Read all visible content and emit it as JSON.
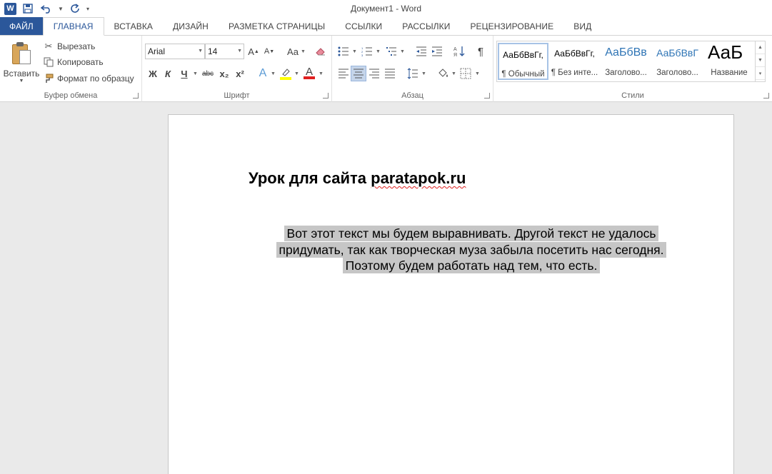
{
  "titlebar": {
    "title": "Документ1 - Word"
  },
  "tabs": [
    "ФАЙЛ",
    "ГЛАВНАЯ",
    "ВСТАВКА",
    "ДИЗАЙН",
    "РАЗМЕТКА СТРАНИЦЫ",
    "ССЫЛКИ",
    "РАССЫЛКИ",
    "РЕЦЕНЗИРОВАНИЕ",
    "ВИД"
  ],
  "clipboard": {
    "paste": "Вставить",
    "cut": "Вырезать",
    "copy": "Копировать",
    "format_painter": "Формат по образцу",
    "label": "Буфер обмена"
  },
  "font": {
    "name": "Arial",
    "size": "14",
    "grow": "A",
    "shrink": "A",
    "case": "Aa",
    "bold": "Ж",
    "italic": "К",
    "underline": "Ч",
    "strike": "abc",
    "subscript": "x₂",
    "superscript": "x²",
    "effects": "A",
    "color": "A",
    "label": "Шрифт",
    "highlight_color": "#ffff00",
    "font_color": "#e02020"
  },
  "paragraph": {
    "pilcrow": "¶",
    "label": "Абзац"
  },
  "styles": {
    "items": [
      {
        "preview": "АаБбВвГг,",
        "name": "¶ Обычный"
      },
      {
        "preview": "АаБбВвГг,",
        "name": "¶ Без инте..."
      },
      {
        "preview": "АаБбВв",
        "name": "Заголово..."
      },
      {
        "preview": "АаБбВвГ",
        "name": "Заголово..."
      },
      {
        "preview": "АаБ",
        "name": "Название"
      }
    ],
    "label": "Стили"
  },
  "document": {
    "heading_prefix": "Урок для сайта ",
    "heading_link": "paratapok.ru",
    "body_lines": [
      "Вот этот текст мы будем выравнивать. Другой текст не удалось",
      "придумать, так как творческая муза забыла посетить нас сегодня.",
      "Поэтому будем работать над тем, что есть."
    ]
  },
  "colors": {
    "accent": "#2b579a",
    "selection": "#c6c6c6"
  }
}
